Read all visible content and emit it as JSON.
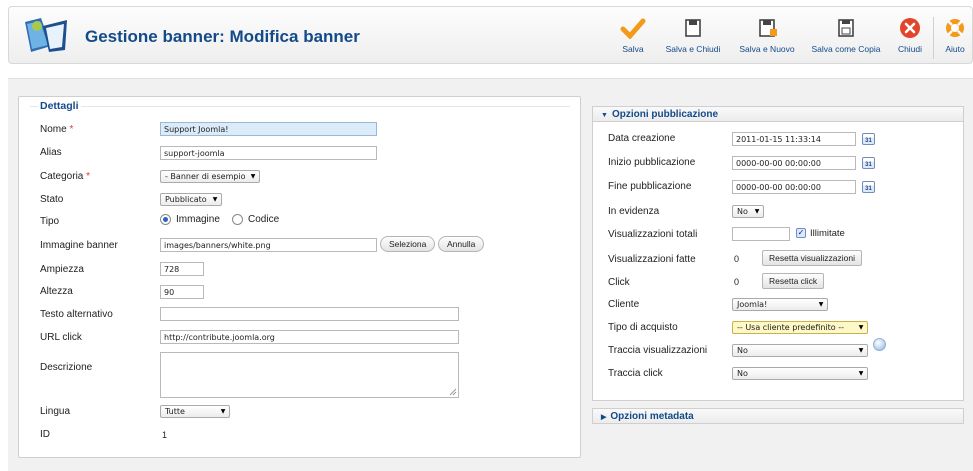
{
  "header": {
    "title": "Gestione banner: Modifica banner"
  },
  "toolbar": {
    "save": "Salva",
    "save_close": "Salva e Chiudi",
    "save_new": "Salva e Nuovo",
    "save_copy": "Salva come Copia",
    "close": "Chiudi",
    "help": "Aiuto"
  },
  "details": {
    "legend": "Dettagli",
    "name_label": "Nome",
    "name_value": "Support Joomla!",
    "alias_label": "Alias",
    "alias_value": "support-joomla",
    "category_label": "Categoria",
    "category_value": "- Banner di esempio",
    "state_label": "Stato",
    "state_value": "Pubblicato",
    "type_label": "Tipo",
    "type_image": "Immagine",
    "type_code": "Codice",
    "image_label": "Immagine banner",
    "image_value": "images/banners/white.png",
    "select_btn": "Seleziona",
    "cancel_btn": "Annulla",
    "width_label": "Ampiezza",
    "width_value": "728",
    "height_label": "Altezza",
    "height_value": "90",
    "alt_label": "Testo alternativo",
    "alt_value": "",
    "url_label": "URL click",
    "url_value": "http://contribute.joomla.org",
    "desc_label": "Descrizione",
    "lang_label": "Lingua",
    "lang_value": "Tutte",
    "id_label": "ID",
    "id_value": "1",
    "required_mark": "*"
  },
  "publishing": {
    "header": "Opzioni pubblicazione",
    "created_label": "Data creazione",
    "created_value": "2011-01-15 11:33:14",
    "start_label": "Inizio pubblicazione",
    "start_value": "0000-00-00 00:00:00",
    "end_label": "Fine pubblicazione",
    "end_value": "0000-00-00 00:00:00",
    "featured_label": "In evidenza",
    "featured_value": "No",
    "total_imp_label": "Visualizzazioni totali",
    "total_imp_value": "",
    "unlimited_label": "Illimitate",
    "made_imp_label": "Visualizzazioni fatte",
    "made_imp_value": "0",
    "reset_imp_btn": "Resetta visualizzazioni",
    "clicks_label": "Click",
    "clicks_value": "0",
    "reset_clicks_btn": "Resetta click",
    "client_label": "Cliente",
    "client_value": "Joomla!",
    "purchase_label": "Tipo di acquisto",
    "purchase_value": "-- Usa cliente predefinito --",
    "track_imp_label": "Traccia visualizzazioni",
    "track_imp_value": "No",
    "track_click_label": "Traccia click",
    "track_click_value": "No",
    "calendar_day": "31"
  },
  "metadata": {
    "header": "Opzioni metadata"
  },
  "colors": {
    "title_blue": "#134a89",
    "required_red": "#d43b3b",
    "save_orange": "#f39a1b",
    "close_red": "#e2452a"
  }
}
